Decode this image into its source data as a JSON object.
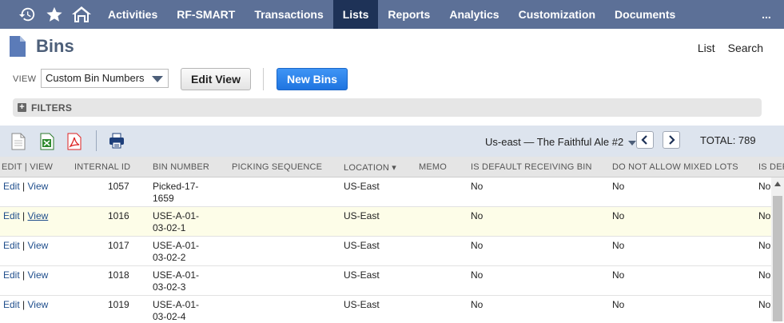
{
  "nav": {
    "items": [
      {
        "label": "Activities"
      },
      {
        "label": "RF-SMART"
      },
      {
        "label": "Transactions"
      },
      {
        "label": "Lists",
        "active": true
      },
      {
        "label": "Reports"
      },
      {
        "label": "Analytics"
      },
      {
        "label": "Customization"
      },
      {
        "label": "Documents"
      }
    ],
    "more": "...",
    "icons": [
      "recent-icon",
      "star-icon",
      "home-icon"
    ]
  },
  "page": {
    "title": "Bins",
    "links": [
      "List",
      "Search"
    ]
  },
  "view": {
    "label": "VIEW",
    "selected": "Custom Bin Numbers",
    "edit_label": "Edit View",
    "new_label": "New Bins"
  },
  "filters": {
    "label": "FILTERS"
  },
  "toolbar": {
    "location": "Us-east — The Faithful Ale #2",
    "prev": "<",
    "next": ">",
    "total": "TOTAL: 789"
  },
  "table": {
    "headers": [
      "EDIT | VIEW",
      "INTERNAL ID",
      "BIN NUMBER",
      "PICKING SEQUENCE",
      "LOCATION ▾",
      "MEMO",
      "IS DEFAULT RECEIVING BIN",
      "DO NOT ALLOW MIXED LOTS",
      "IS DEF"
    ],
    "edit": "Edit",
    "view": "View",
    "sep": "|",
    "rows": [
      {
        "id": "1057",
        "bin1": "Picked-17-",
        "bin2": "1659",
        "location": "US-East",
        "default_recv": "No",
        "no_mixed": "No",
        "is_def": "No"
      },
      {
        "id": "1016",
        "bin1": "USE-A-01-",
        "bin2": "03-02-1",
        "location": "US-East",
        "default_recv": "No",
        "no_mixed": "No",
        "is_def": "No"
      },
      {
        "id": "1017",
        "bin1": "USE-A-01-",
        "bin2": "03-02-2",
        "location": "US-East",
        "default_recv": "No",
        "no_mixed": "No",
        "is_def": "No"
      },
      {
        "id": "1018",
        "bin1": "USE-A-01-",
        "bin2": "03-02-3",
        "location": "US-East",
        "default_recv": "No",
        "no_mixed": "No",
        "is_def": "No"
      },
      {
        "id": "1019",
        "bin1": "USE-A-01-",
        "bin2": "03-02-4",
        "location": "US-East",
        "default_recv": "No",
        "no_mixed": "No",
        "is_def": "No"
      }
    ]
  },
  "colors": {
    "nav_bg": "#5c7097",
    "nav_active": "#1e3257",
    "primary_button": "#1f74e0",
    "link": "#1f4e8c"
  }
}
